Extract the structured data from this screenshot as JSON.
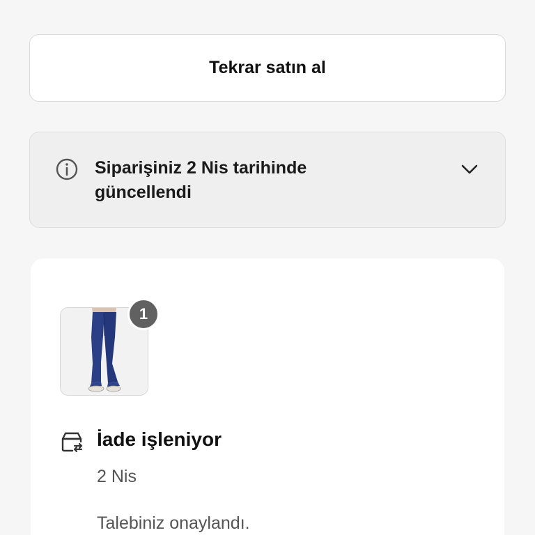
{
  "actions": {
    "buy_again_label": "Tekrar satın al"
  },
  "order_update": {
    "message": "Siparişiniz 2 Nis tarihinde güncellendi",
    "icon": "info-icon",
    "toggle_icon": "chevron-down-icon"
  },
  "item": {
    "quantity": "1",
    "image": "jeans-product-thumbnail"
  },
  "return_status": {
    "icon": "return-box-icon",
    "title": "İade işleniyor",
    "date": "2 Nis",
    "message": "Talebiniz onaylandı."
  },
  "colors": {
    "background": "#f6f6f6",
    "badge": "#616161",
    "denim": "#2b3f86"
  }
}
